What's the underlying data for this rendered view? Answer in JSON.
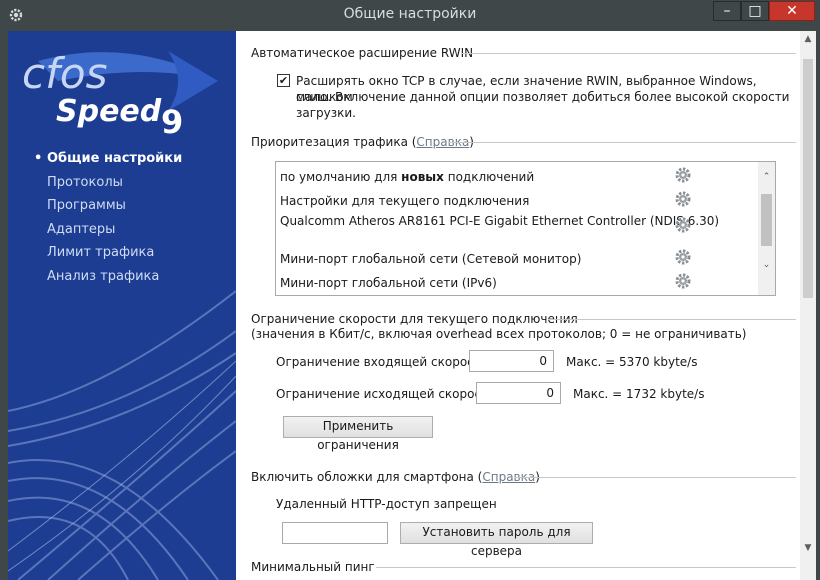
{
  "window": {
    "title": "Общие настройки",
    "minimize_label": "–",
    "maximize_label": "□",
    "close_label": "✕"
  },
  "logo": {
    "text_top": "cfos",
    "text_bottom": "Speed",
    "version": "9"
  },
  "sidebar": {
    "bullet": "•",
    "items": [
      {
        "label": "Общие настройки",
        "active": true
      },
      {
        "label": "Протоколы",
        "active": false
      },
      {
        "label": "Программы",
        "active": false
      },
      {
        "label": "Адаптеры",
        "active": false
      },
      {
        "label": "Лимит трафика",
        "active": false
      },
      {
        "label": "Анализ трафика",
        "active": false
      }
    ]
  },
  "rwin": {
    "section_title": "Автоматическое расширение RWIN",
    "checkbox_checked": true,
    "checkbox_mark": "✔",
    "description_lines": [
      "Расширять окно TCP в случае, если значение RWIN, выбранное Windows, слишком",
      "мало. Включение данной опции позволяет добиться более высокой скорости",
      "загрузки."
    ]
  },
  "priority": {
    "section_title_prefix": "Приоритезация трафика (",
    "help_link": "Справка",
    "section_title_suffix": ")",
    "rows": [
      {
        "prefix": "по умолчанию для ",
        "bold": "новых",
        "suffix": " подключений"
      },
      {
        "prefix": "Настройки для текущего подключения",
        "bold": "",
        "suffix": ""
      },
      {
        "prefix": "Qualcomm Atheros AR8161 PCI-E Gigabit Ethernet Controller (NDIS 6.30)",
        "bold": "",
        "suffix": ""
      },
      {
        "prefix": "Мини-порт глобальной сети (Сетевой монитор)",
        "bold": "",
        "suffix": ""
      },
      {
        "prefix": "Мини-порт глобальной сети (IPv6)",
        "bold": "",
        "suffix": ""
      }
    ]
  },
  "limits": {
    "section_title": "Ограничение скорости для текущего подключения",
    "note": "(значения в Кбит/с, включая overhead всех протоколов; 0 = не ограничивать)",
    "incoming_label": "Ограничение входящей скорости",
    "incoming_value": "0",
    "incoming_max": "Макс. = 5370 kbyte/s",
    "outgoing_label": "Ограничение исходящей скорости",
    "outgoing_value": "0",
    "outgoing_max": "Макс. = 1732 kbyte/s",
    "apply_button": "Применить ограничения"
  },
  "skins": {
    "section_title_prefix": "Включить обложки для смартфона (",
    "help_link": "Справка",
    "section_title_suffix": ")",
    "status": "Удаленный HTTP-доступ запрещен",
    "password_value": "",
    "set_password_button": "Установить пароль для сервера"
  },
  "ping": {
    "section_title": "Минимальный пинг"
  },
  "scroll": {
    "up": "▲",
    "down": "▼",
    "list_up": "⌃",
    "list_down": "⌄"
  },
  "colors": {
    "sidebar_bg": "#1d3d92",
    "titlebar": "#3f4749",
    "close_button": "#c7362a"
  }
}
